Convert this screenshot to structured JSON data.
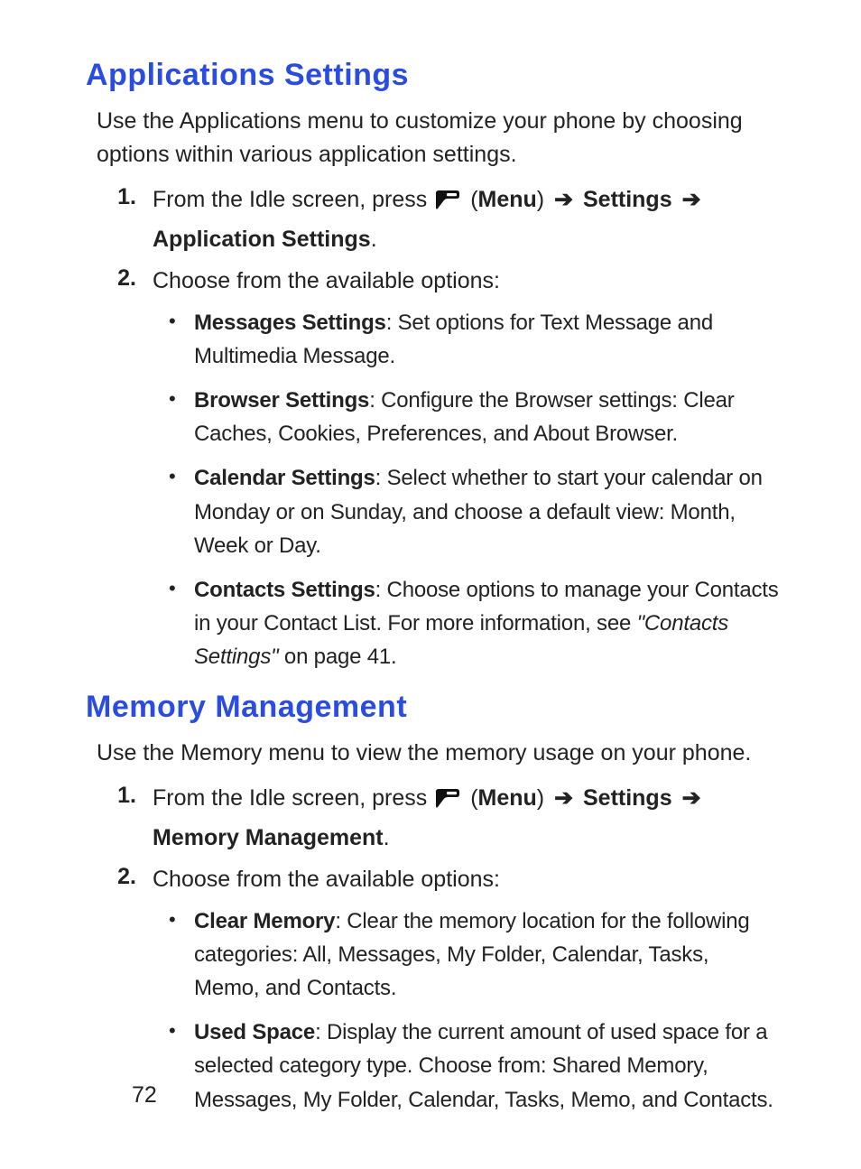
{
  "pageNumber": "72",
  "arrow_glyph": "➔",
  "sections": [
    {
      "heading": "Applications Settings",
      "intro": "Use the Applications menu to customize your phone by choosing options within various application settings.",
      "steps": [
        {
          "num": "1.",
          "prefix": "From the Idle screen, press ",
          "nav_menu": "Menu",
          "nav_path1": "Settings",
          "nav_path2": "Application Settings"
        },
        {
          "num": "2.",
          "text": "Choose from the available options:"
        }
      ],
      "bullets": [
        {
          "name": "Messages Settings",
          "desc": ": Set options for Text Message and Multimedia Message."
        },
        {
          "name": "Browser Settings",
          "desc": ": Configure the Browser settings: Clear Caches, Cookies, Preferences, and About Browser."
        },
        {
          "name": "Calendar Settings",
          "desc": ": Select whether to start your calendar on Monday or on Sunday, and choose a default view: Month, Week or Day."
        },
        {
          "name": "Contacts Settings",
          "desc_pre": ": Choose options to manage your Contacts in your Contact List. For more information, see ",
          "ref": "\"Contacts Settings\"",
          "desc_post": " on page 41."
        }
      ]
    },
    {
      "heading": "Memory Management",
      "intro": "Use the Memory menu to view the memory usage on your phone.",
      "steps": [
        {
          "num": "1.",
          "prefix": "From the Idle screen, press ",
          "nav_menu": "Menu",
          "nav_path1": "Settings",
          "nav_path2": "Memory Management"
        },
        {
          "num": "2.",
          "text": "Choose from the available options:"
        }
      ],
      "bullets": [
        {
          "name": "Clear Memory",
          "desc": ": Clear the memory location for the following categories: All, Messages, My Folder, Calendar, Tasks, Memo, and Contacts."
        },
        {
          "name": "Used Space",
          "desc": ": Display the current amount of used space for a selected category type. Choose from: Shared Memory, Messages, My Folder, Calendar, Tasks, Memo, and Contacts."
        }
      ]
    }
  ]
}
